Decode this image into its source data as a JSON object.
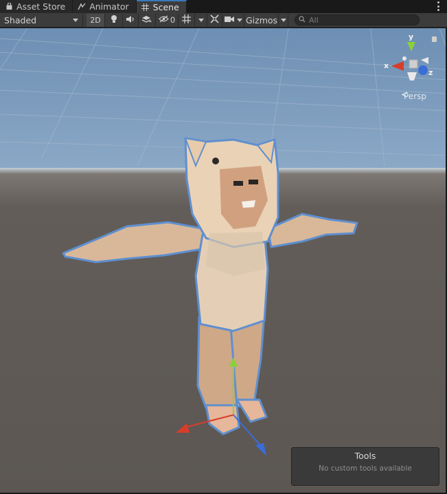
{
  "tabs": [
    {
      "label": "Asset Store",
      "icon": "shopping-bag-icon",
      "active": false
    },
    {
      "label": "Animator",
      "icon": "animator-icon",
      "active": false
    },
    {
      "label": "Scene",
      "icon": "grid-icon",
      "active": true
    }
  ],
  "toolbar": {
    "shading_mode": "Shaded",
    "mode_2d_label": "2D",
    "hidden_count": "0",
    "gizmos_label": "Gizmos",
    "search_placeholder": "All"
  },
  "viewport": {
    "gizmo_axis_labels": {
      "x": "x",
      "y": "y",
      "z": "z"
    },
    "projection_label": "Persp",
    "axis_colors": {
      "x": "#d83d2a",
      "y": "#8ad139",
      "z": "#3a6dd8"
    },
    "selection_outline_color": "#5f8fcf"
  },
  "tools_overlay": {
    "title": "Tools",
    "message": "No custom tools available"
  }
}
